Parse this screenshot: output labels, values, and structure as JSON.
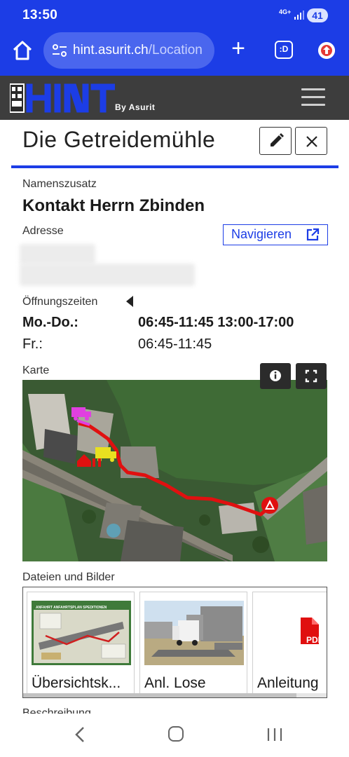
{
  "status_bar": {
    "time": "13:50",
    "network": "4G+",
    "battery": "41"
  },
  "browser": {
    "url_host": "hint.asurit.ch",
    "url_path": "/Location",
    "tabs_label": ":D",
    "icons": [
      "home-icon",
      "site-settings-icon",
      "plus-icon",
      "tabs-icon",
      "update-icon"
    ]
  },
  "app": {
    "logo_text": "HINT",
    "logo_byline": "By Asurit"
  },
  "location": {
    "title": "Die Getreidemühle",
    "name_suffix_label": "Namenszusatz",
    "name_suffix": "Kontakt Herrn Zbinden",
    "address_label": "Adresse",
    "navigate_label": "Navigieren",
    "opening_hours_label": "Öffnungszeiten",
    "hours": [
      {
        "day": "Mo.-Do.:",
        "time": "06:45-11:45 13:00-17:00",
        "bold": true
      },
      {
        "day": "Fr.:",
        "time": "06:45-11:45",
        "bold": false
      }
    ],
    "map_label": "Karte",
    "files_label": "Dateien und Bilder",
    "files": [
      {
        "caption": "Übersichtsk...",
        "thumb_title": "ANFAHRT ANFAHRTSPLAN SPEDITIONEN"
      },
      {
        "caption": "Anl. Lose"
      },
      {
        "caption": "Anleitung",
        "badge": "PDF"
      }
    ],
    "description_label": "Beschreibung"
  },
  "colors": {
    "brand_blue": "#1c3de6",
    "header_dark": "#3d3d3d",
    "route_red": "#e01010",
    "truck_magenta": "#e040e0",
    "truck_yellow": "#e8e020"
  }
}
